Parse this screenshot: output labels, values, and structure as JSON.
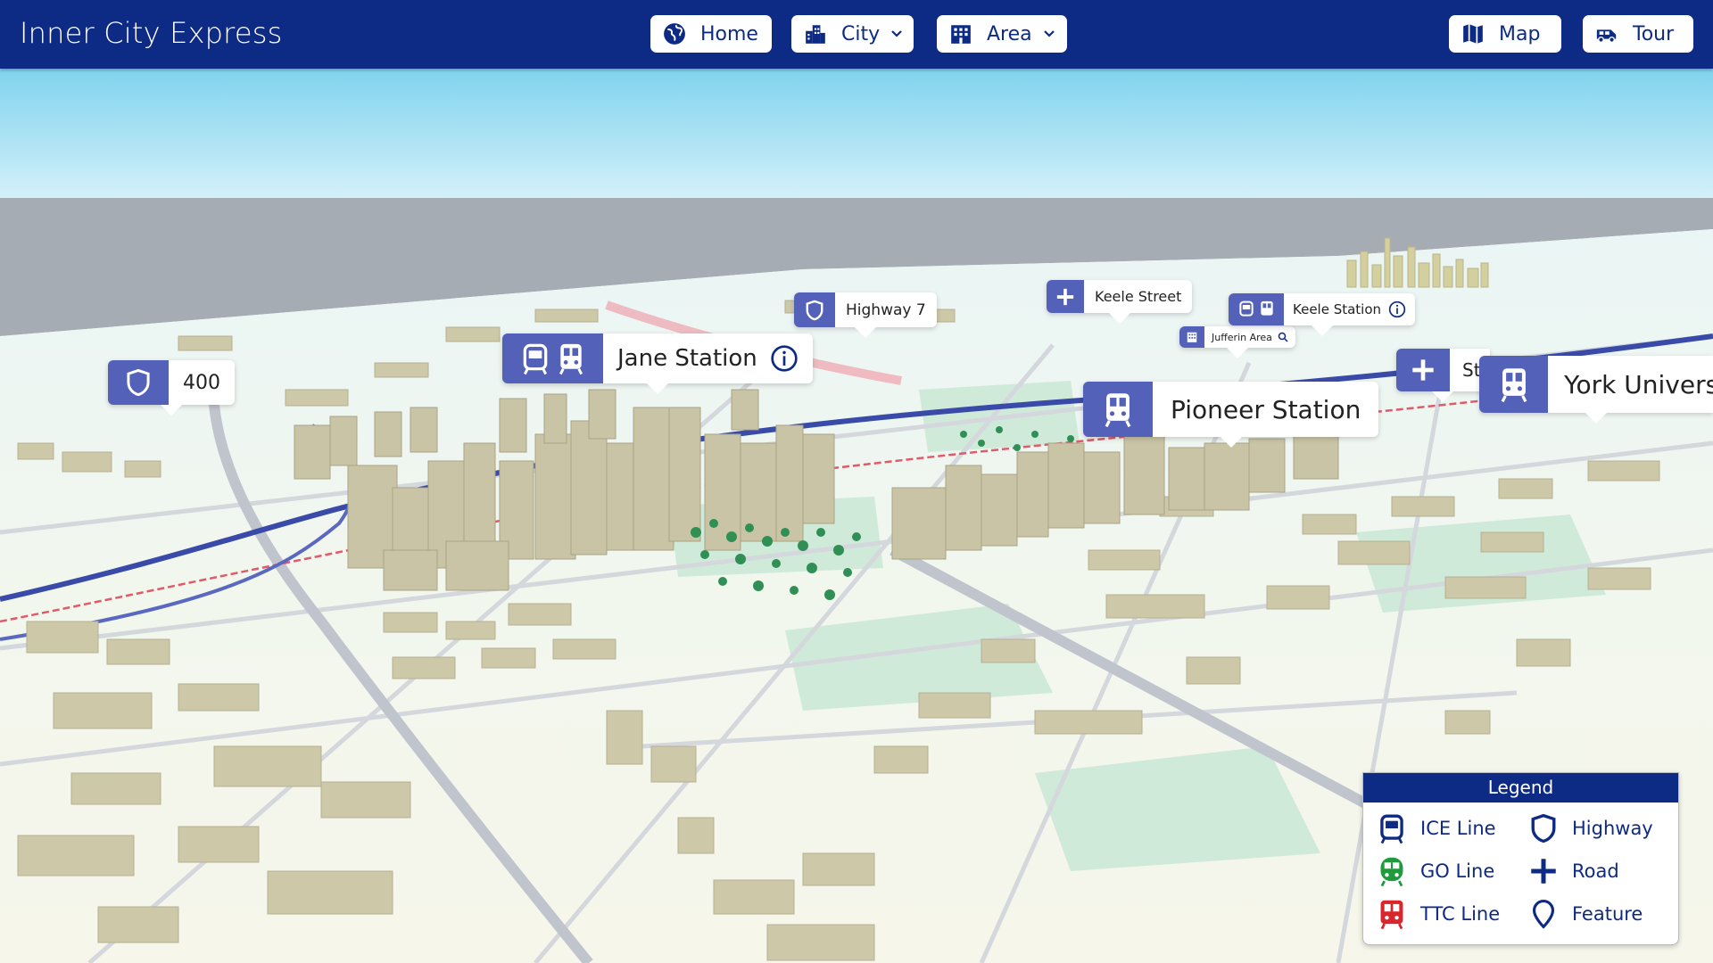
{
  "app": {
    "title": "Inner City Express"
  },
  "nav": {
    "home": "Home",
    "city": "City",
    "area": "Area",
    "map": "Map",
    "tour": "Tour"
  },
  "callouts": {
    "highway_400": "400",
    "jane_station": "Jane Station",
    "highway_7": "Highway 7",
    "keele_street": "Keele Street",
    "jufferin_area": "Jufferin Area",
    "keele_station": "Keele Station",
    "pioneer_station": "Pioneer Station",
    "st_partial": "St",
    "york_university": "York Univers"
  },
  "legend": {
    "title": "Legend",
    "items": [
      {
        "label": "ICE Line",
        "icon": "tram-icon",
        "color": "#0d2a84"
      },
      {
        "label": "Highway",
        "icon": "shield-icon",
        "color": "#0d2a84"
      },
      {
        "label": "GO Line",
        "icon": "train-icon",
        "color": "#1f9a3c"
      },
      {
        "label": "Road",
        "icon": "cross-icon",
        "color": "#0d2a84"
      },
      {
        "label": "TTC Line",
        "icon": "subway-icon",
        "color": "#d8262c"
      },
      {
        "label": "Feature",
        "icon": "pin-icon",
        "color": "#0d2a84"
      }
    ]
  },
  "colors": {
    "header": "#0d2a84",
    "callout_icon_bg": "#5461b8",
    "transit_line": "#3a4aa8",
    "rail_line": "#e05a6a"
  }
}
